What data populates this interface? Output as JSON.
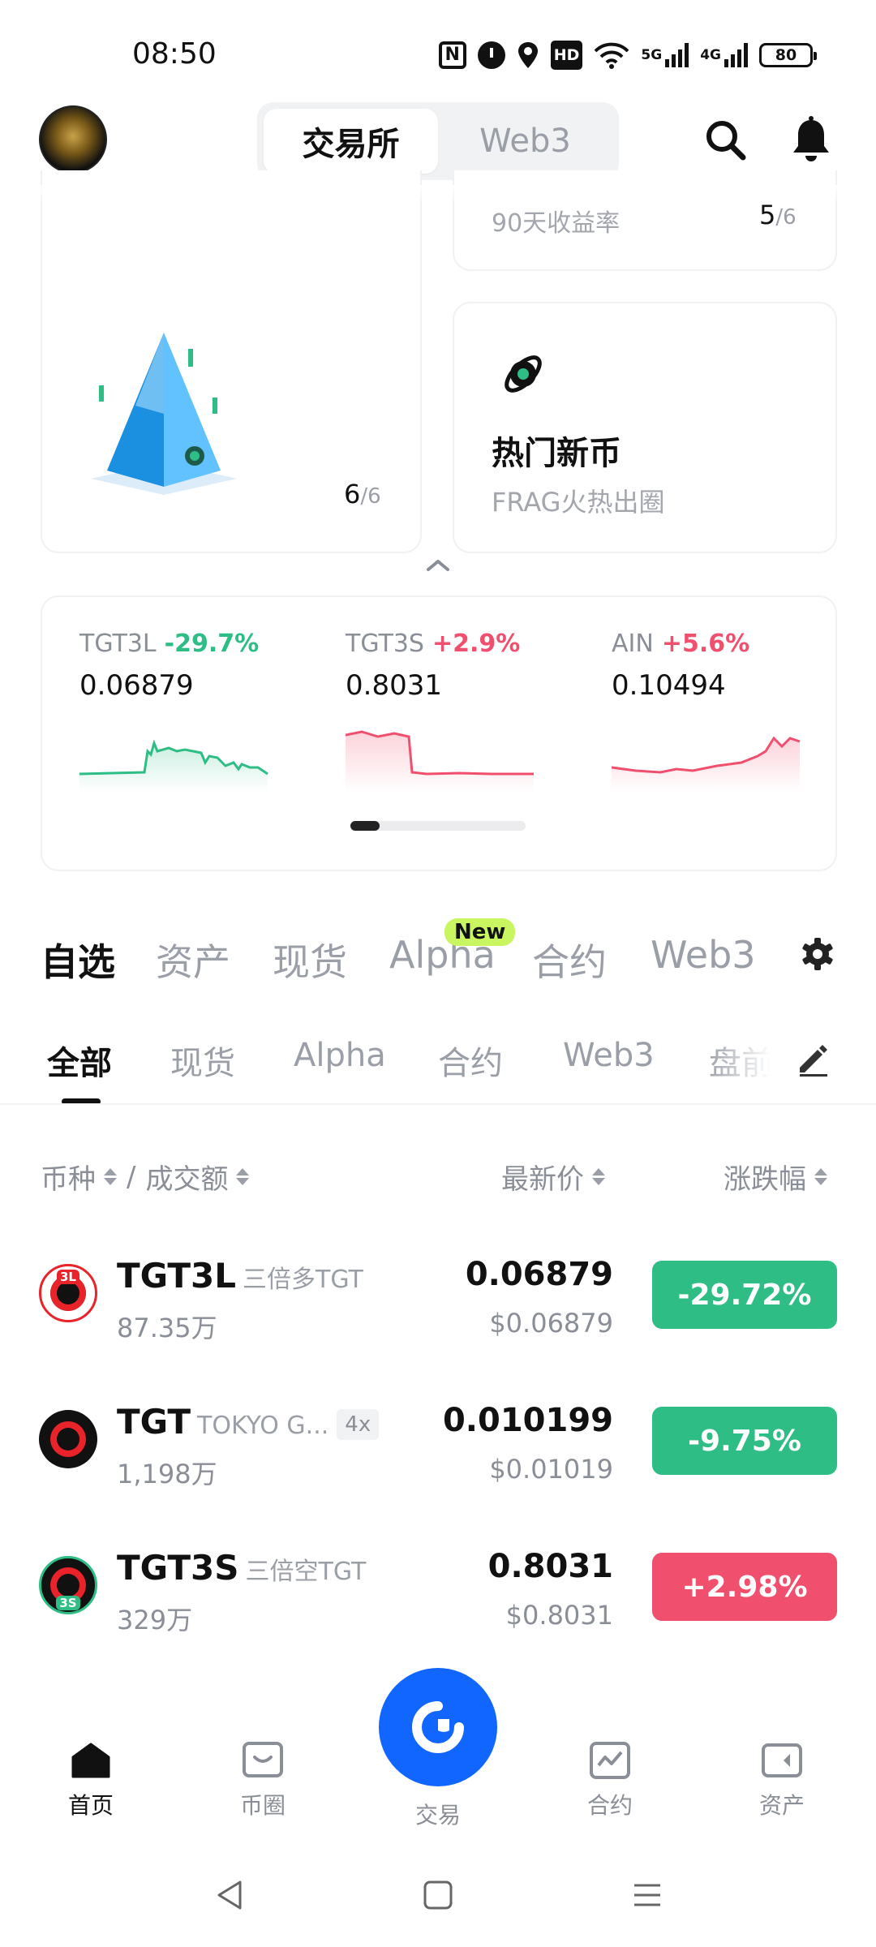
{
  "status_bar": {
    "time": "08:50",
    "network_a": "5G",
    "network_b": "4G",
    "hd": "HD",
    "battery": "80"
  },
  "header": {
    "tabs": [
      {
        "label": "交易所",
        "active": true
      },
      {
        "label": "Web3",
        "active": false
      }
    ],
    "icons": [
      "search-icon",
      "bell-icon"
    ]
  },
  "cards": {
    "big": {
      "page": "6",
      "total": "/6"
    },
    "top_right": {
      "label": "90天收益率",
      "page": "5",
      "total": "/6"
    },
    "hot": {
      "title": "热门新币",
      "subtitle": "FRAG火热出圈"
    }
  },
  "tickers": [
    {
      "symbol": "TGT3L",
      "change": "-29.7%",
      "price": "0.06879",
      "direction": "down",
      "color": "#2ebd85"
    },
    {
      "symbol": "TGT3S",
      "change": "+2.9%",
      "price": "0.8031",
      "direction": "up",
      "color": "#f0506e"
    },
    {
      "symbol": "AIN",
      "change": "+5.6%",
      "price": "0.10494",
      "direction": "up",
      "color": "#f0506e"
    }
  ],
  "main_tabs": [
    {
      "label": "自选",
      "active": true
    },
    {
      "label": "资产",
      "active": false
    },
    {
      "label": "现货",
      "active": false
    },
    {
      "label": "Alpha",
      "active": false,
      "badge": "New"
    },
    {
      "label": "合约",
      "active": false
    },
    {
      "label": "Web3",
      "active": false
    }
  ],
  "sub_tabs": [
    {
      "label": "全部",
      "active": true
    },
    {
      "label": "现货",
      "active": false
    },
    {
      "label": "Alpha",
      "active": false
    },
    {
      "label": "合约",
      "active": false
    },
    {
      "label": "Web3",
      "active": false
    },
    {
      "label": "盘前",
      "active": false
    }
  ],
  "columns": {
    "coin": "币种",
    "separator": "/",
    "volume": "成交额",
    "price": "最新价",
    "change": "涨跌幅"
  },
  "rows": [
    {
      "symbol": "TGT3L",
      "subtitle": "三倍多TGT",
      "leverage": "",
      "volume": "87.35万",
      "price": "0.06879",
      "usd": "$0.06879",
      "change": "-29.72%",
      "direction": "down",
      "tag": "3L"
    },
    {
      "symbol": "TGT",
      "subtitle": "TOKYO G...",
      "leverage": "4x",
      "volume": "1,198万",
      "price": "0.010199",
      "usd": "$0.01019",
      "change": "-9.75%",
      "direction": "down",
      "tag": ""
    },
    {
      "symbol": "TGT3S",
      "subtitle": "三倍空TGT",
      "leverage": "",
      "volume": "329万",
      "price": "0.8031",
      "usd": "$0.8031",
      "change": "+2.98%",
      "direction": "up",
      "tag": "3S"
    }
  ],
  "bottom_nav": [
    {
      "label": "首页",
      "icon": "home-icon",
      "active": true
    },
    {
      "label": "币圈",
      "icon": "community-icon",
      "active": false
    },
    {
      "label": "交易",
      "icon": "trade-icon",
      "active": false
    },
    {
      "label": "合约",
      "icon": "futures-icon",
      "active": false
    },
    {
      "label": "资产",
      "icon": "wallet-icon",
      "active": false
    }
  ],
  "colors": {
    "green": "#2ebd85",
    "red": "#f0506e",
    "brand_blue": "#1166ff",
    "new_badge": "#c8f560"
  }
}
